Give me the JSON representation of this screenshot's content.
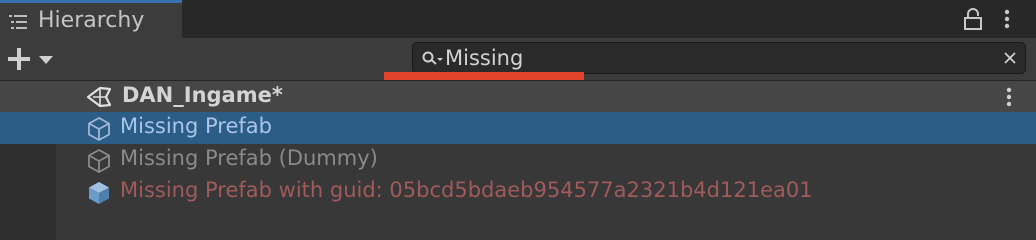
{
  "window": {
    "tab_title": "Hierarchy",
    "tab_icon": "hierarchy-list-icon"
  },
  "toolbar": {
    "add_icon": "plus-icon",
    "dropdown_icon": "chevron-down-icon",
    "search_value": "Missing",
    "search_icon": "search-icon",
    "clear_icon": "close-icon"
  },
  "scene": {
    "name": "DAN_Ingame*",
    "icon": "unity-icon"
  },
  "tree": {
    "items": [
      {
        "label": "Missing Prefab",
        "state": "selected",
        "icon": "prefab-cube-outline-icon"
      },
      {
        "label": "Missing Prefab (Dummy)",
        "state": "inactive",
        "icon": "prefab-cube-outline-icon"
      },
      {
        "label": "Missing Prefab with guid: 05bcd5bdaeb954577a2321b4d121ea01",
        "state": "missing",
        "icon": "prefab-cube-filled-icon"
      }
    ]
  },
  "colors": {
    "selection": "#2c5d87",
    "highlight_underline": "#e2412a",
    "missing_text": "#a05a5a"
  }
}
